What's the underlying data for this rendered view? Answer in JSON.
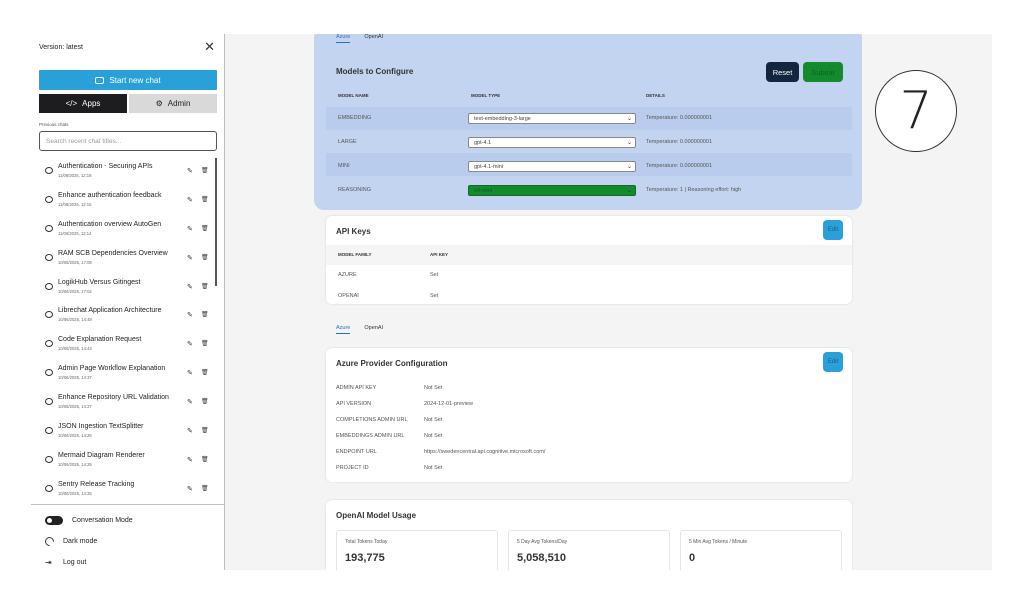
{
  "sidebar": {
    "version": "Version: latest",
    "close": "✕",
    "start_new_chat": "Start new chat",
    "apps_label": "Apps",
    "admin_label": "Admin",
    "previous_chats_label": "Previous chats",
    "search_placeholder": "Search recent chat titles...",
    "chats": [
      {
        "title": "Authentication - Securing APIs",
        "date": "11/06/2025, 12:16"
      },
      {
        "title": "Enhance authentication feedback",
        "date": "11/06/2025, 12:15"
      },
      {
        "title": "Authentication overview AutoGen",
        "date": "11/06/2025, 12:14"
      },
      {
        "title": "RAM SCB Dependencies Overview",
        "date": "10/06/2025, 17:09"
      },
      {
        "title": "LogikHub Versus Gitingest",
        "date": "10/06/2025, 17:02"
      },
      {
        "title": "Librechat Application Architecture",
        "date": "10/06/2025, 14:48"
      },
      {
        "title": "Code Explanation Request",
        "date": "10/06/2025, 14:43"
      },
      {
        "title": "Admin Page Workflow Explanation",
        "date": "10/06/2025, 14:37"
      },
      {
        "title": "Enhance Repository URL Validation",
        "date": "10/06/2025, 14:27"
      },
      {
        "title": "JSON Ingestion TextSplitter",
        "date": "10/06/2025, 14:26"
      },
      {
        "title": "Mermaid Diagram Renderer",
        "date": "10/06/2025, 14:25"
      },
      {
        "title": "Sentry Release Tracking",
        "date": "10/06/2025, 14:25"
      }
    ],
    "conversation_mode": "Conversation Mode",
    "dark_mode": "Dark mode",
    "log_out": "Log out"
  },
  "models_section": {
    "tabs": [
      "Azure",
      "OpenAI"
    ],
    "title": "Models to Configure",
    "reset_label": "Reset",
    "submit_label": "Submit",
    "headers": {
      "name": "MODEL NAME",
      "type": "MODEL TYPE",
      "details": "DETAILS"
    },
    "rows": [
      {
        "name": "EMBEDDING",
        "type": "text-embedding-3-large",
        "details": "Temperature: 0.000000001"
      },
      {
        "name": "LARGE",
        "type": "gpt-4.1",
        "details": "Temperature: 0.000000001"
      },
      {
        "name": "MINI",
        "type": "gpt-4.1-mini",
        "details": "Temperature: 0.000000001"
      },
      {
        "name": "REASONING",
        "type": "o4-mini",
        "details": "Temperature: 1 | Reasoning effort: high"
      }
    ]
  },
  "api_keys": {
    "title": "API Keys",
    "edit_label": "Edit",
    "headers": {
      "family": "MODEL FAMILY",
      "key": "API KEY"
    },
    "rows": [
      {
        "family": "AZURE",
        "key": "Set"
      },
      {
        "family": "OPENAI",
        "key": "Set"
      }
    ]
  },
  "provider_section": {
    "tabs": [
      "Azure",
      "OpenAI"
    ],
    "title": "Azure Provider Configuration",
    "edit_label": "Edit",
    "rows": [
      {
        "label": "ADMIN API KEY",
        "value": "Not Set"
      },
      {
        "label": "API VERSION",
        "value": "2024-12-01-preview"
      },
      {
        "label": "COMPLETIONS ADMIN URL",
        "value": "Not Set"
      },
      {
        "label": "EMBEDDINGS ADMIN URL",
        "value": "Not Set"
      },
      {
        "label": "ENDPOINT URL",
        "value": "https://swedencentral.api.cognitive.microsoft.com/"
      },
      {
        "label": "PROJECT ID",
        "value": "Not Set"
      }
    ]
  },
  "usage": {
    "title": "OpenAI Model Usage",
    "stats": [
      {
        "label": "Total Tokens Today",
        "value": "193,775"
      },
      {
        "label": "5 Day Avg Tokens/Day",
        "value": "5,058,510"
      },
      {
        "label": "5 Min Avg Tokens / Minute",
        "value": "0"
      }
    ]
  },
  "step_marker": "7",
  "colors": {
    "accent_blue": "#2aa0d8",
    "dark_navy": "#12263f",
    "green": "#138a2e",
    "highlight": "#c3d4f0"
  }
}
